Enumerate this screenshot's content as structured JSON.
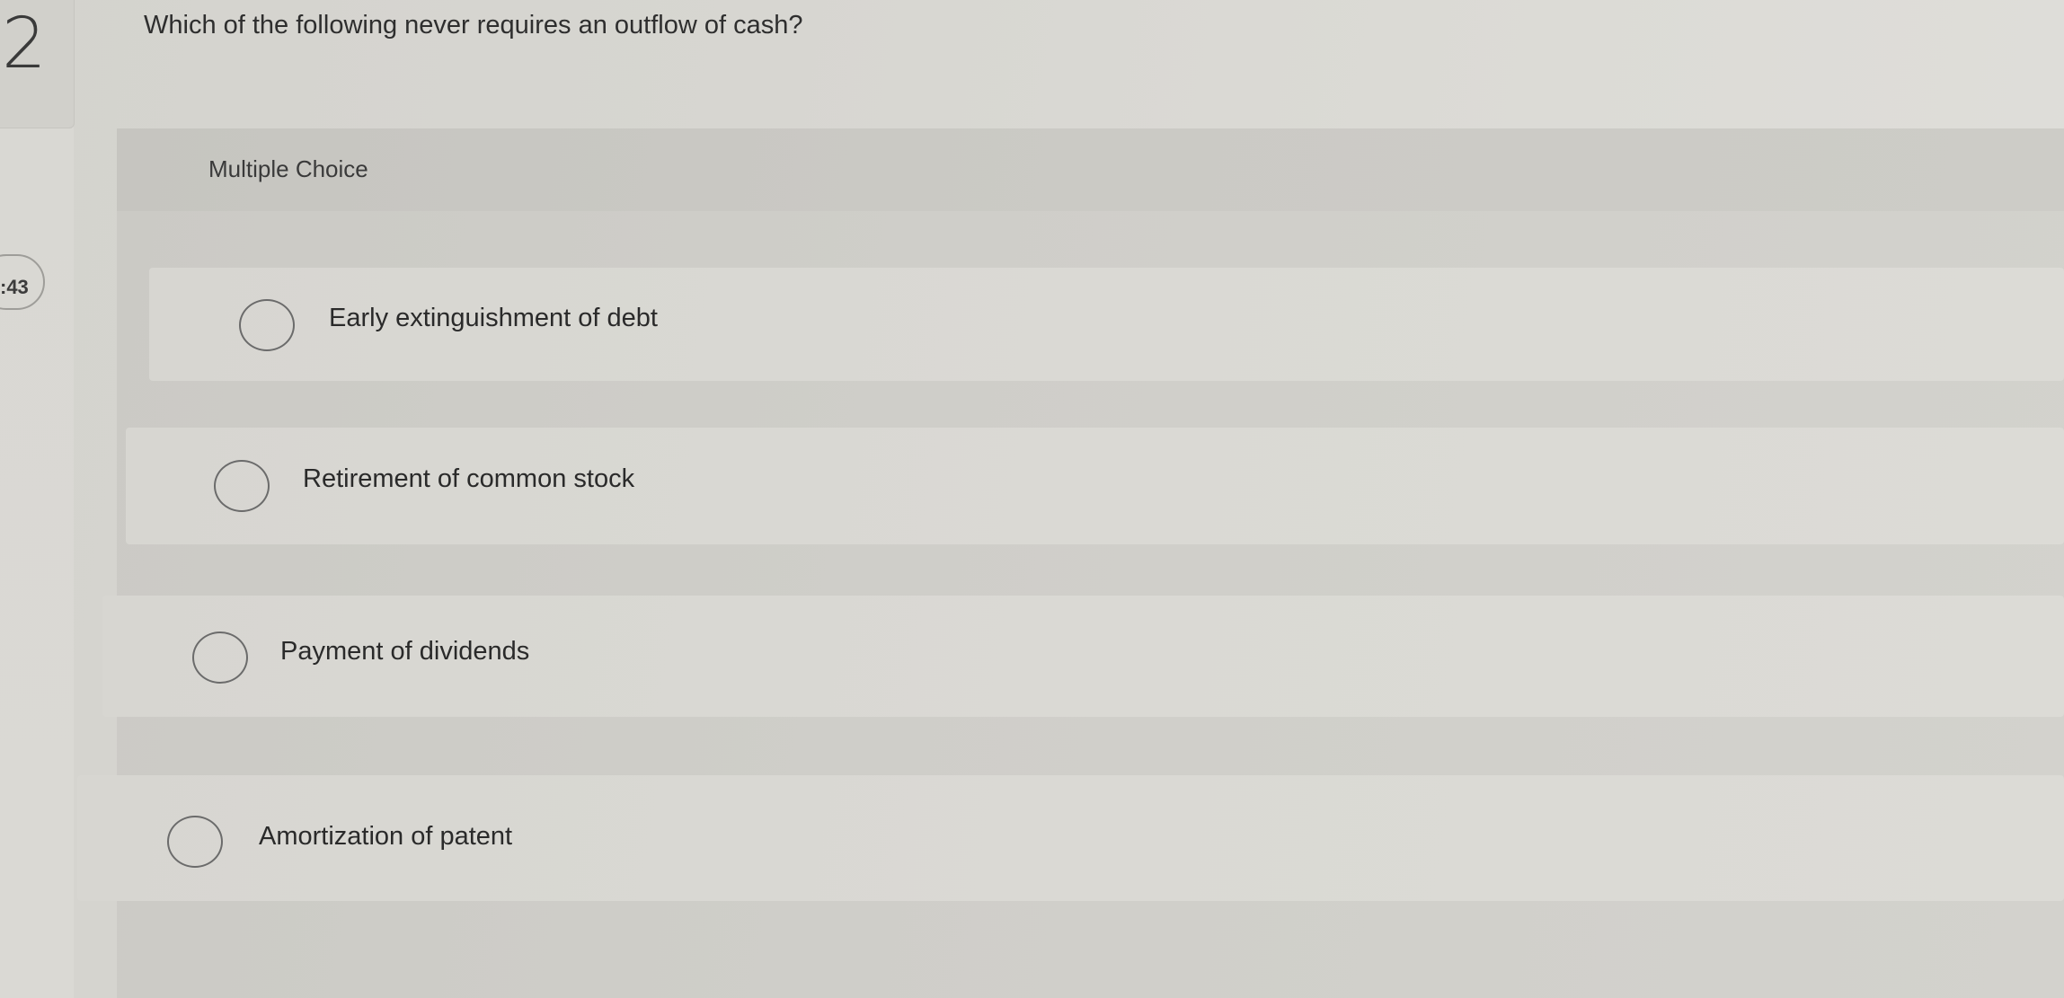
{
  "question": {
    "number": "2",
    "points_fragment": ":43",
    "text": "Which of the following never requires an outflow of cash?"
  },
  "answer_area": {
    "type_label": "Multiple Choice",
    "choices": [
      {
        "label": "Early extinguishment of debt",
        "selected": false
      },
      {
        "label": "Retirement of common stock",
        "selected": false
      },
      {
        "label": "Payment of dividends",
        "selected": false
      },
      {
        "label": "Amortization of patent",
        "selected": false
      }
    ]
  },
  "colors": {
    "background": "#d7d6d1",
    "text": "#2b2b2b",
    "radio_border": "#6b6b6b"
  }
}
